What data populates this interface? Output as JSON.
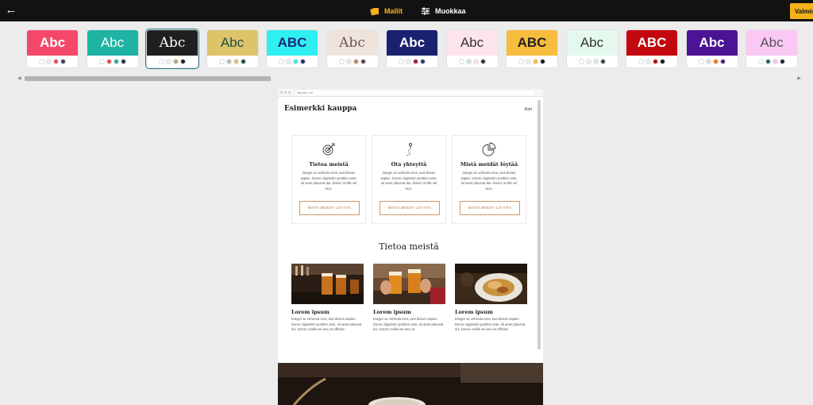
{
  "topbar": {
    "back_icon": "arrow-left-icon",
    "tabs": [
      {
        "label": "Mallit",
        "icon": "templates-icon",
        "active": true
      },
      {
        "label": "Muokkaa",
        "icon": "sliders-icon",
        "active": false
      }
    ],
    "done_label": "Valmis",
    "accent": "#f4b11a"
  },
  "themes": [
    {
      "label": "Abc",
      "bg": "#f4486b",
      "fg": "#ffffff",
      "dots": [
        "#ffffff",
        "#eeeeee",
        "#f4486b",
        "#3a3f63"
      ]
    },
    {
      "label": "Abc",
      "bg": "#1fb3a4",
      "fg": "#ffffff",
      "dots": [
        "#ffffff",
        "#e54b4b",
        "#1fb3a4",
        "#243447"
      ]
    },
    {
      "label": "Abc",
      "bg": "#1f1f1f",
      "fg": "#ffffff",
      "dots": [
        "#ffffff",
        "#eeeeee",
        "#c1a07a",
        "#1f1f1f"
      ],
      "selected": true
    },
    {
      "label": "Abc",
      "bg": "#ddc36a",
      "fg": "#1f4d44",
      "dots": [
        "#ffffff",
        "#b0bcb8",
        "#ddc36a",
        "#1f4d44"
      ]
    },
    {
      "label": "ABC",
      "bg": "#2ef0f0",
      "fg": "#1b2a7a",
      "dots": [
        "#ffffff",
        "#eeeeee",
        "#2ef0f0",
        "#1b2a7a"
      ]
    },
    {
      "label": "Abc",
      "bg": "#efe4dc",
      "fg": "#6a5a52",
      "dots": [
        "#ffffff",
        "#efe4dc",
        "#c08a5a",
        "#5a4a44"
      ]
    },
    {
      "label": "Abc",
      "bg": "#1a2270",
      "fg": "#ffffff",
      "dots": [
        "#ffffff",
        "#eeeeee",
        "#a01c3c",
        "#2b3c6b"
      ]
    },
    {
      "label": "Abc",
      "bg": "#fde4ec",
      "fg": "#333333",
      "dots": [
        "#ffffff",
        "#bfe6ef",
        "#fde4ec",
        "#333333"
      ]
    },
    {
      "label": "ABC",
      "bg": "#f8bd3e",
      "fg": "#222222",
      "dots": [
        "#ffffff",
        "#eeeeee",
        "#f8bd3e",
        "#111111"
      ]
    },
    {
      "label": "Abc",
      "bg": "#e4f8ee",
      "fg": "#333333",
      "dots": [
        "#ffffff",
        "#eeeeee",
        "#d0eede",
        "#444444"
      ]
    },
    {
      "label": "ABC",
      "bg": "#c3070f",
      "fg": "#ffffff",
      "dots": [
        "#ffffff",
        "#eeeeee",
        "#c3070f",
        "#111111"
      ]
    },
    {
      "label": "Abc",
      "bg": "#4b1494",
      "fg": "#ffffff",
      "dots": [
        "#ffffff",
        "#dddddd",
        "#f07b1b",
        "#4b1494"
      ]
    },
    {
      "label": "Abc",
      "bg": "#fbc8f4",
      "fg": "#555555",
      "dots": [
        "#ffffff",
        "#1b6f6a",
        "#fbc8f4",
        "#222222"
      ]
    }
  ],
  "preview": {
    "url": "tarjoatu.net",
    "site_title": "Esimerkki kauppa",
    "cart_label": "Kori",
    "features": [
      {
        "icon": "target-icon",
        "title": "Tietoa meistä",
        "text": "Integer ac vehicula eros, sed dictum sapien. Donec dignissim porttitor ante, sit amet placerat dui. Donec mollis vel arcu.",
        "button": "MISTÄ MEIDÄT LÖYTÄÄ"
      },
      {
        "icon": "path-pin-icon",
        "title": "Ota yhteyttä",
        "text": "Integer ac vehicula eros, sed dictum sapien. Donec dignissim porttitor ante, sit amet placerat dui. Donec mollis vel arcu.",
        "button": "MISTÄ MEIDÄT LÖYTÄÄ"
      },
      {
        "icon": "pie-chart-icon",
        "title": "Mistä meidät löytää",
        "text": "Integer ac vehicula eros, sed dictum sapien. Donec dignissim porttitor ante, sit amet placerat dui. Donec mollis vel arcu.",
        "button": "MISTÄ MEIDÄT LÖYTÄÄ"
      }
    ],
    "section_title": "Tietoa meistä",
    "posts": [
      {
        "image": "beer-glasses-photo",
        "title": "Lorem ipsum",
        "text": "Integer ac vehicula eros, sed dictum sapien. Donec dignissim porttitor ante, sit amet placerat dui. Donec mollis vel arcu et efficitur."
      },
      {
        "image": "toast-beers-photo",
        "title": "Lorem ipsum",
        "text": "Integer ac vehicula eros, sed dictum sapien. Donec dignissim porttitor ante, sit amet placerat dui. Donec mollis vel arcu et."
      },
      {
        "image": "food-plate-photo",
        "title": "Lorem ipsum",
        "text": "Integer ac vehicula eros, sed dictum sapien. Donec dignissim porttitor ante, sit amet placerat dui. Donec mollis vel arcu et efficitur."
      }
    ],
    "hero_image": "coffee-cup-photo"
  }
}
